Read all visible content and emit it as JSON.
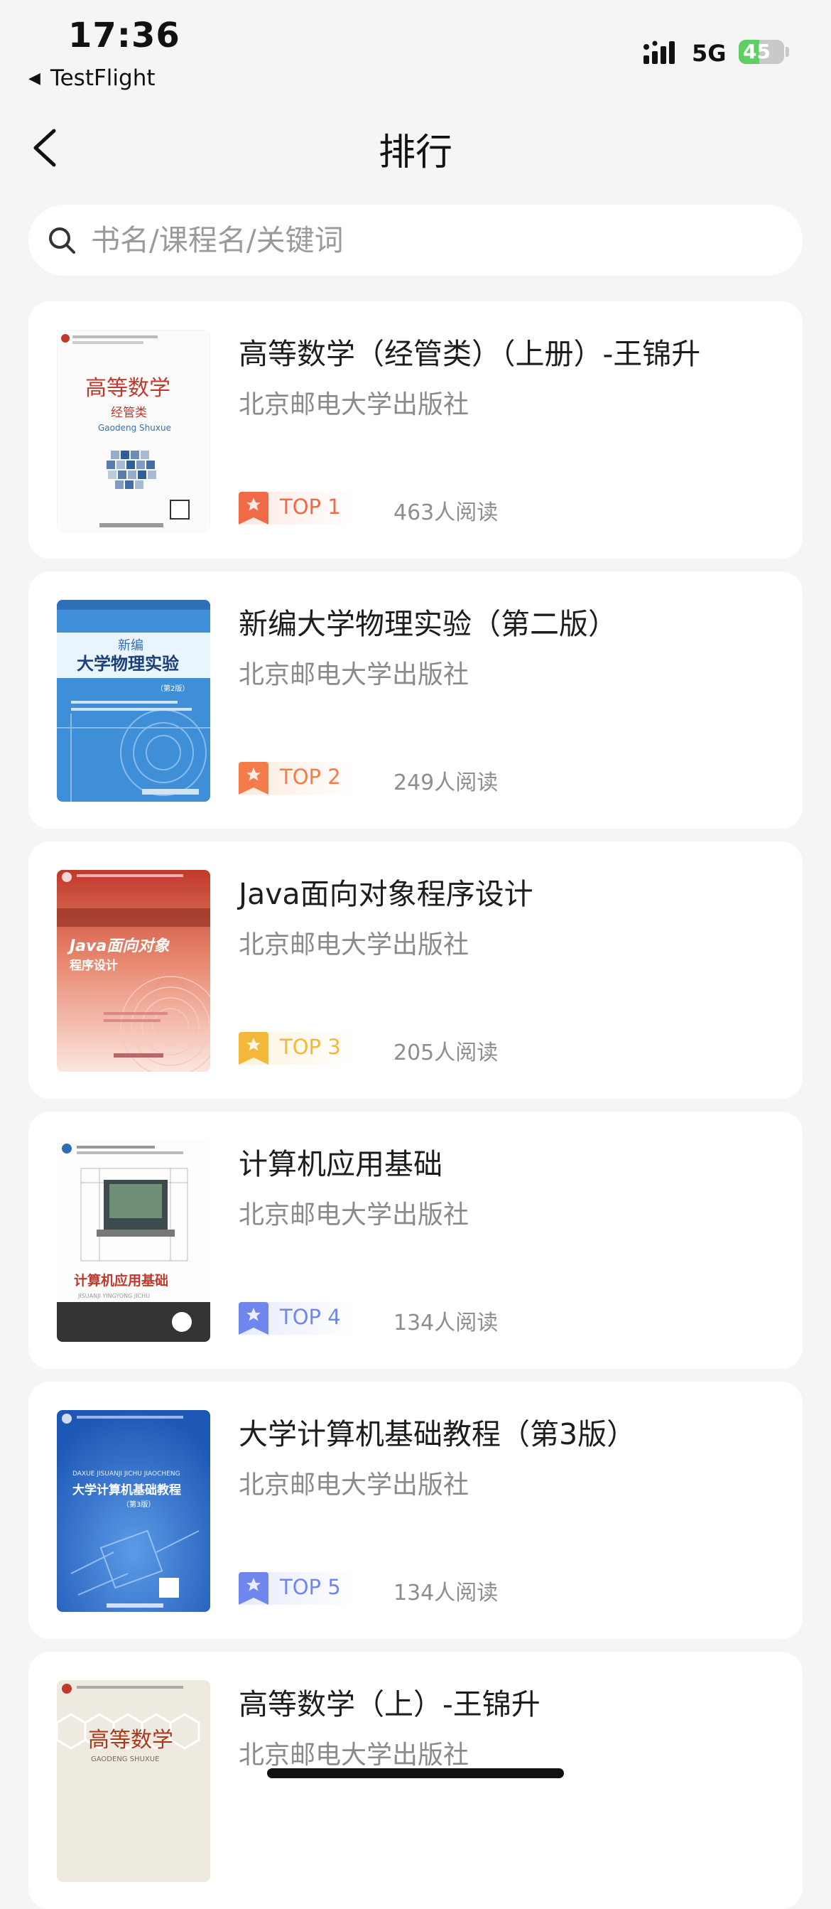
{
  "status": {
    "time": "17:36",
    "back_app": "TestFlight",
    "network": "5G",
    "battery": "45",
    "battery_level": 0.45
  },
  "nav": {
    "title": "排行"
  },
  "search": {
    "placeholder": "书名/课程名/关键词",
    "value": ""
  },
  "books": [
    {
      "title": "高等数学（经管类）（上册）-王锦升",
      "publisher": "北京邮电大学出版社",
      "rank": "TOP 1",
      "reads": "463人阅读",
      "rank_color": "#f06a48",
      "rank_bg": "#fde8e1",
      "cover_text": {
        "title": "高等数学",
        "sub": "经管类",
        "pinyin": "Gaodeng Shuxue"
      }
    },
    {
      "title": "新编大学物理实验（第二版）",
      "publisher": "北京邮电大学出版社",
      "rank": "TOP 2",
      "reads": "249人阅读",
      "rank_color": "#f47c4a",
      "rank_bg": "#fdeadc",
      "cover_text": {
        "title": "大学物理实验",
        "sub": "新编",
        "edition": "（第2版）"
      }
    },
    {
      "title": "Java面向对象程序设计",
      "publisher": "北京邮电大学出版社",
      "rank": "TOP 3",
      "reads": "205人阅读",
      "rank_color": "#f3b73a",
      "rank_bg": "#fdf3dc",
      "cover_text": {
        "title": "Java面向对象",
        "sub": "程序设计"
      }
    },
    {
      "title": "计算机应用基础",
      "publisher": "北京邮电大学出版社",
      "rank": "TOP 4",
      "reads": "134人阅读",
      "rank_color": "#6f86ef",
      "rank_bg": "#e6ebfd",
      "cover_text": {
        "title": "计算机应用基础",
        "pinyin": "JISUANJI YINGYONG JICHU"
      }
    },
    {
      "title": "大学计算机基础教程（第3版）",
      "publisher": "北京邮电大学出版社",
      "rank": "TOP 5",
      "reads": "134人阅读",
      "rank_color": "#6f86ef",
      "rank_bg": "#e6ebfd",
      "cover_text": {
        "title": "大学计算机基础教程",
        "pinyin": "DAXUE JISUANJI JICHU JIAOCHENG",
        "edition": "（第3版）"
      }
    },
    {
      "title": "高等数学（上）-王锦升",
      "publisher": "北京邮电大学出版社",
      "rank": "",
      "reads": "",
      "rank_color": "#6f86ef",
      "rank_bg": "#e6ebfd",
      "cover_text": {
        "title": "高等数学",
        "pinyin": "GAODENG SHUXUE"
      }
    }
  ]
}
